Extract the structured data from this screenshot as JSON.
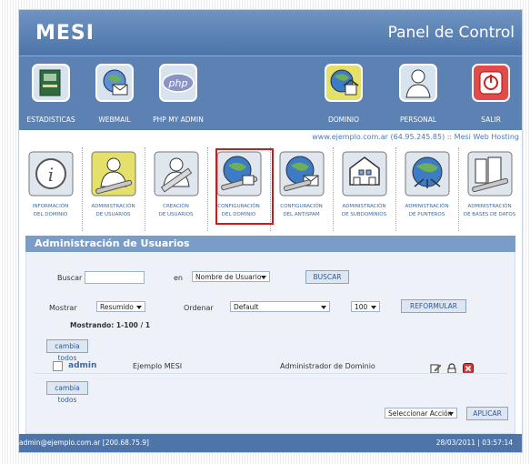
{
  "header": {
    "logo": "MESI",
    "title": "Panel de Control"
  },
  "nav_main": [
    {
      "label": "ESTADISTICAS",
      "icon": "statistics-icon"
    },
    {
      "label": "WEBMAIL",
      "icon": "webmail-icon"
    },
    {
      "label": "PHP MY ADMIN",
      "icon": "php-icon"
    },
    {
      "label": "DOMINIO",
      "icon": "domain-globe-icon"
    },
    {
      "label": "PERSONAL",
      "icon": "personal-user-icon"
    },
    {
      "label": "SALIR",
      "icon": "power-exit-icon"
    }
  ],
  "site_info": "www.ejemplo.com.ar (64.95.245.85) :: Mesi Web Hosting",
  "nav_sub": [
    {
      "line1": "INFORMACIÓN",
      "line2": "DEL DOMINIO",
      "icon": "info-icon"
    },
    {
      "line1": "ADMINISTRACIÓN",
      "line2": "DE USUARIOS",
      "icon": "admin-users-icon"
    },
    {
      "line1": "CREACIÓN",
      "line2": "DE USUARIOS",
      "icon": "create-users-icon"
    },
    {
      "line1": "CONFIGURACIÓN",
      "line2": "DEL DOMINIO",
      "icon": "domain-config-icon"
    },
    {
      "line1": "CONFIGURACIÓN",
      "line2": "DEL ANTISPAM",
      "icon": "antispam-config-icon"
    },
    {
      "line1": "ADMINISTRACIÓN",
      "line2": "DE SUBDOMINIOS",
      "icon": "subdomains-icon"
    },
    {
      "line1": "ADMINISTRACIÓN",
      "line2": "DE PUNTEROS",
      "icon": "pointers-icon"
    },
    {
      "line1": "ADMINISTRACIÓN",
      "line2": "DE BASES DE DATOS",
      "icon": "databases-icon"
    }
  ],
  "panel": {
    "title": "Administración de Usuarios",
    "search": {
      "label": "Buscar",
      "value": "",
      "in_label": "en",
      "field": "Nombre de Usuario",
      "button": "BUSCAR"
    },
    "show": {
      "label": "Mostrar",
      "value": "Resumido",
      "order_label": "Ordenar",
      "order_value": "Default",
      "count": "100",
      "button": "REFORMULAR"
    },
    "showing": "Mostrando: 1-100 / 1",
    "toggle_all": "cambia todos",
    "rows": [
      {
        "user": "admin",
        "name": "Ejemplo MESI",
        "role": "Administrador de Dominio"
      }
    ],
    "action_select": "Seleccionar Acción",
    "apply": "APLICAR"
  },
  "footer": {
    "user": "admin@ejemplo.com.ar [200.68.75.9]",
    "datetime": "28/03/2011 | 03:57:14"
  },
  "colors": {
    "header": "#5b82b3",
    "accent": "#3a6aa4",
    "highlight": "#d01a1a"
  }
}
